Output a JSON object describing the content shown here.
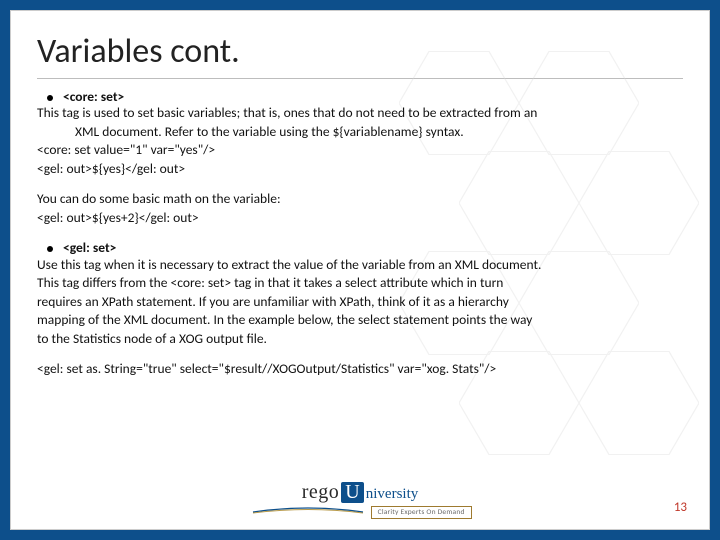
{
  "title": "Variables cont.",
  "section1": {
    "tag": "<core: set>",
    "desc1": "This tag is used to set basic variables; that is, ones that do not need to be extracted from an",
    "desc2": "XML document. Refer to the variable using the ${variablename} syntax.",
    "code1": "<core: set value=\"1\" var=\"yes\"/>",
    "code2": "<gel: out>${yes}</gel: out>"
  },
  "section2": {
    "line1": "You can do some basic math on the variable:",
    "code": "<gel: out>${yes+2}</gel: out>"
  },
  "section3": {
    "tag": "<gel: set>",
    "p1": "Use this tag when it is necessary to extract the value of the variable from an XML document.",
    "p2": "This tag differs from the <core: set> tag in that it takes a select attribute which in turn",
    "p3": "requires an XPath statement. If you are unfamiliar with XPath, think of it as a hierarchy",
    "p4": "mapping of the XML document. In the example below, the select statement points the way",
    "p5": "to the Statistics node of a XOG output file."
  },
  "section4": {
    "code": "<gel: set as. String=\"true\" select=\"$result//XOGOutput/Statistics\" var=\"xog. Stats\"/>"
  },
  "logo": {
    "brand": "rego",
    "u": "U",
    "suffix": "niversity",
    "tag": "Clarity Experts On Demand"
  },
  "page": "13"
}
